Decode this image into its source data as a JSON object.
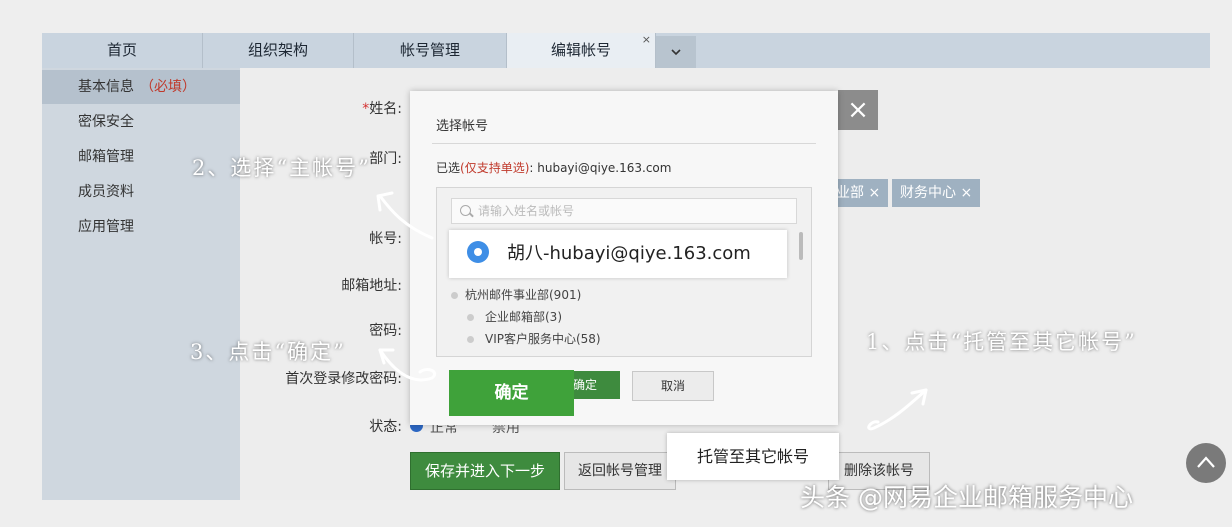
{
  "tabs": [
    {
      "label": "首页"
    },
    {
      "label": "组织架构"
    },
    {
      "label": "帐号管理"
    },
    {
      "label": "编辑帐号",
      "active": true
    }
  ],
  "tab_close_glyph": "×",
  "sidebar": {
    "items": [
      {
        "label": "基本信息",
        "note": "（必填）",
        "active": true
      },
      {
        "label": "密保安全"
      },
      {
        "label": "邮箱管理"
      },
      {
        "label": "成员资料"
      },
      {
        "label": "应用管理"
      }
    ]
  },
  "form": {
    "name_label": "姓名:",
    "dept_label": "部门:",
    "account_label": "帐号:",
    "mailbox_label": "邮箱地址:",
    "password_label": "密码:",
    "first_login_label": "首次登录修改密码:",
    "status_label": "状态:",
    "status_enabled": "正常",
    "status_disabled": "禁用",
    "dept_tags": [
      {
        "label": "业部 ×"
      },
      {
        "label": "财务中心 ×"
      }
    ],
    "save_button": "保存并进入下一步",
    "return_button": "返回帐号管理",
    "delete_button": "删除该帐号"
  },
  "dialog": {
    "title": "选择帐号",
    "selected_prefix": "已选",
    "selected_hint": "(仅支持单选)",
    "selected_value": ": hubayi@qiye.163.com",
    "search_placeholder": "请输入姓名或帐号",
    "tree": [
      {
        "label": "杭州邮件事业部(901)"
      },
      {
        "label": "企业邮箱部(3)"
      },
      {
        "label": "VIP客户服务中心(58)"
      }
    ],
    "confirm": "确定",
    "cancel": "取消"
  },
  "callouts": {
    "account_option": "胡八-hubayi@qiye.163.com",
    "confirm_button": "确定",
    "delegate_button": "托管至其它帐号"
  },
  "notes": {
    "step1": "1、点击“托管至其它帐号”",
    "step2": "2、选择“主帐号”",
    "step3": "3、点击“确定”"
  },
  "close_glyph": "×",
  "scroll_top_glyph": "^",
  "watermark": "头条 @网易企业邮箱服务中心",
  "colors": {
    "accent_green": "#3fa23a",
    "selected_blue": "#3e8ee6",
    "required_red": "#c0392b"
  }
}
